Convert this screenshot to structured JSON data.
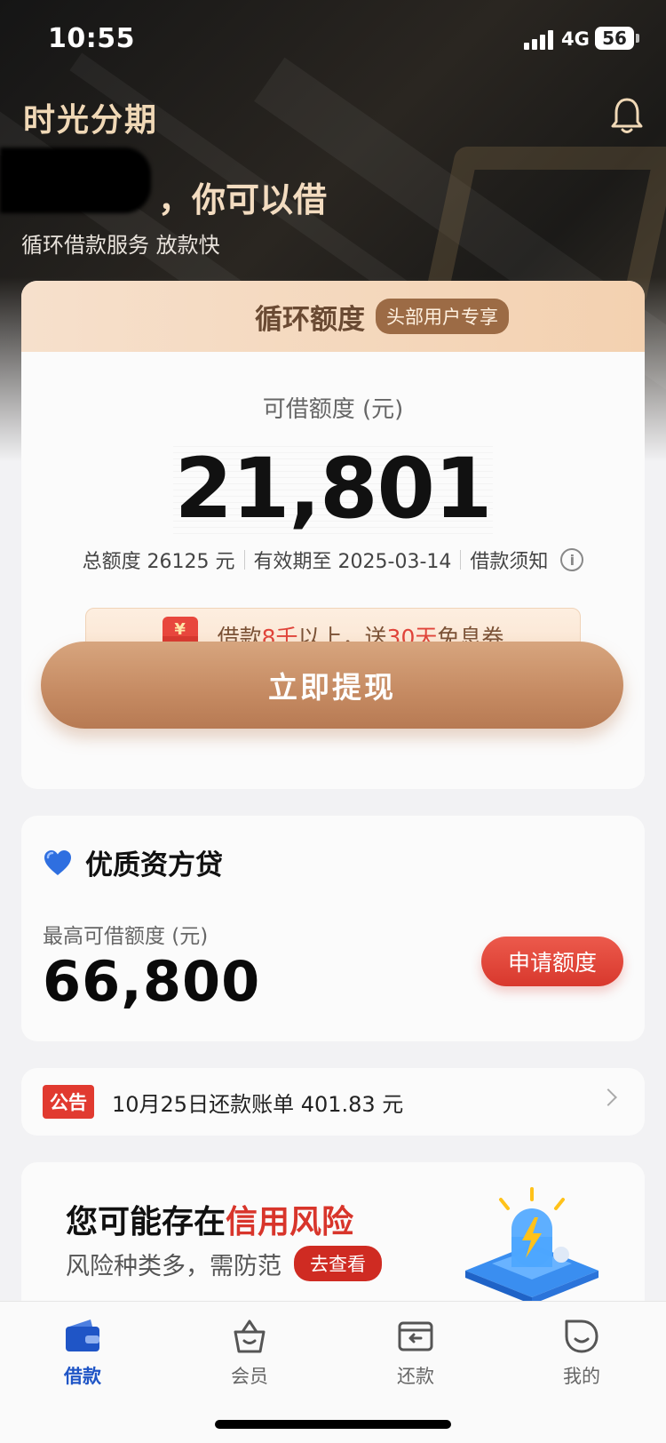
{
  "status_bar": {
    "time": "10:55",
    "network": "4G",
    "battery": "56"
  },
  "header": {
    "app_title": "时光分期",
    "headline": "，你可以借",
    "subline": "循环借款服务 放款快"
  },
  "main_card": {
    "title": "循环额度",
    "badge": "头部用户专享",
    "available_label": "可借额度 (元)",
    "available_amount": "21,801",
    "total_quota": "总额度 26125 元",
    "validity": "有效期至 2025-03-14",
    "notice_link": "借款须知",
    "info_glyph": "i",
    "promo": {
      "part1": "借款",
      "highlight1": "8千",
      "part2": "以上，送",
      "highlight2": "30天",
      "part3": "免息券",
      "envelope_glyph": "¥"
    },
    "cta_label": "立即提现"
  },
  "quality_card": {
    "title": "优质资方贷",
    "label": "最高可借额度 (元)",
    "amount": "66,800",
    "button": "申请额度"
  },
  "notice": {
    "tag": "公告",
    "text": "10月25日还款账单 401.83 元"
  },
  "risk_card": {
    "title_prefix": "您可能存在",
    "title_highlight": "信用风险",
    "subtitle": "风险种类多，需防范",
    "button": "去查看"
  },
  "tabbar": {
    "items": [
      {
        "label": "借款",
        "icon": "wallet-icon",
        "active": true
      },
      {
        "label": "会员",
        "icon": "basket-icon",
        "active": false
      },
      {
        "label": "还款",
        "icon": "card-icon",
        "active": false
      },
      {
        "label": "我的",
        "icon": "smile-icon",
        "active": false
      }
    ]
  },
  "colors": {
    "accent_gold": "#c58a62",
    "accent_red": "#d8352b",
    "active_blue": "#1f55c6"
  }
}
